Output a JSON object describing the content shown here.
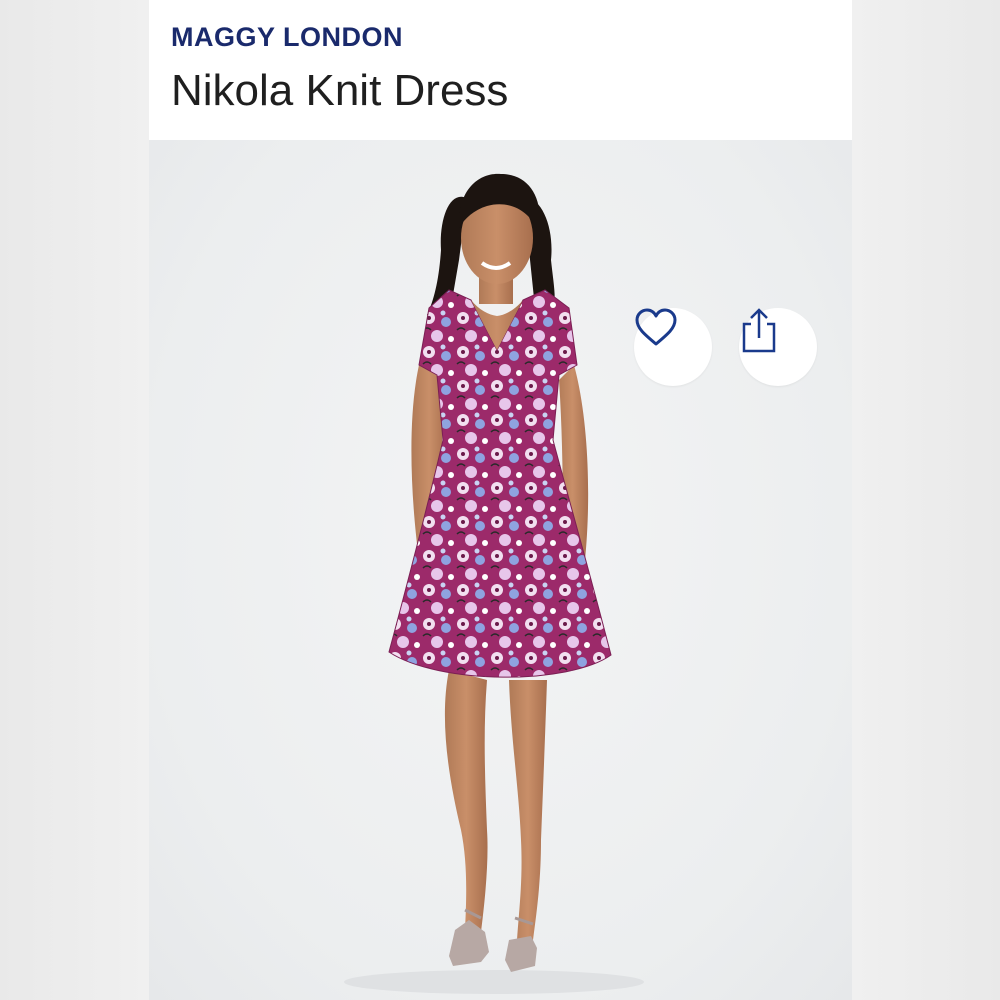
{
  "product": {
    "brand": "MAGGY LONDON",
    "name": "Nikola Knit Dress"
  },
  "actions": {
    "favorite_icon": "heart-icon",
    "share_icon": "share-icon"
  },
  "colors": {
    "brand_text": "#1a2a6c",
    "title_text": "#1f1f1f",
    "dress_base": "#9c2a6a",
    "icon_stroke": "#1a3a8c"
  }
}
